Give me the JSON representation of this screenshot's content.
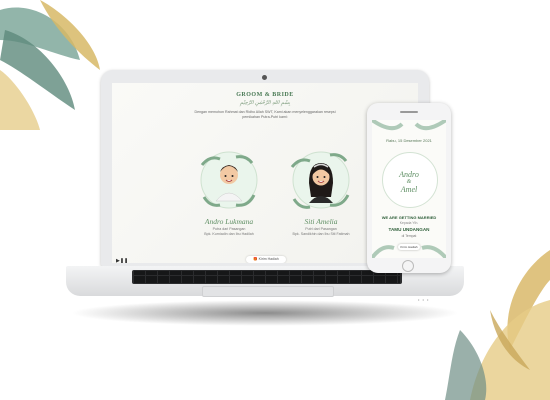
{
  "laptop": {
    "title": "GROOM & BRIDE",
    "arabic": "بِسْمِ اللهِ الرَّحْمٰنِ الرَّحِيْمِ",
    "intro": "Dengan memohon Rahmat dan Ridho Allah SWT, Kami akan menyelenggarakan resepsi pernikahan Putra-Putri kami:",
    "groom": {
      "name": "Andro Lukmana",
      "line1": "Putra dari Pasangan",
      "line2": "Bpk. Kurniadin dan Ibu Hadilah"
    },
    "bride": {
      "name": "Siti Amelia",
      "line1": "Putri dari Pasangan",
      "line2": "Bpk. Sandikhin dan Ibu Siti Fatimah"
    },
    "gift_button": "Kirim Hadiah",
    "music_icon": "music-player-icon"
  },
  "phone": {
    "date": "Rabu, 15 Desember 2021",
    "name1": "Andro",
    "amp": "&",
    "name2": "Amel",
    "getting_married": "WE ARE GETTING MARRIED",
    "kepada": "Kepada Yth.",
    "guest": "TAMU UNDANGAN",
    "tempat": "di Tempat",
    "open_button": "Kirim Hadiah"
  },
  "colors": {
    "accent": "#5f8f64",
    "dark_green": "#2f5f3a",
    "leaf": "#6f9a88",
    "gold": "#d9b86a"
  }
}
